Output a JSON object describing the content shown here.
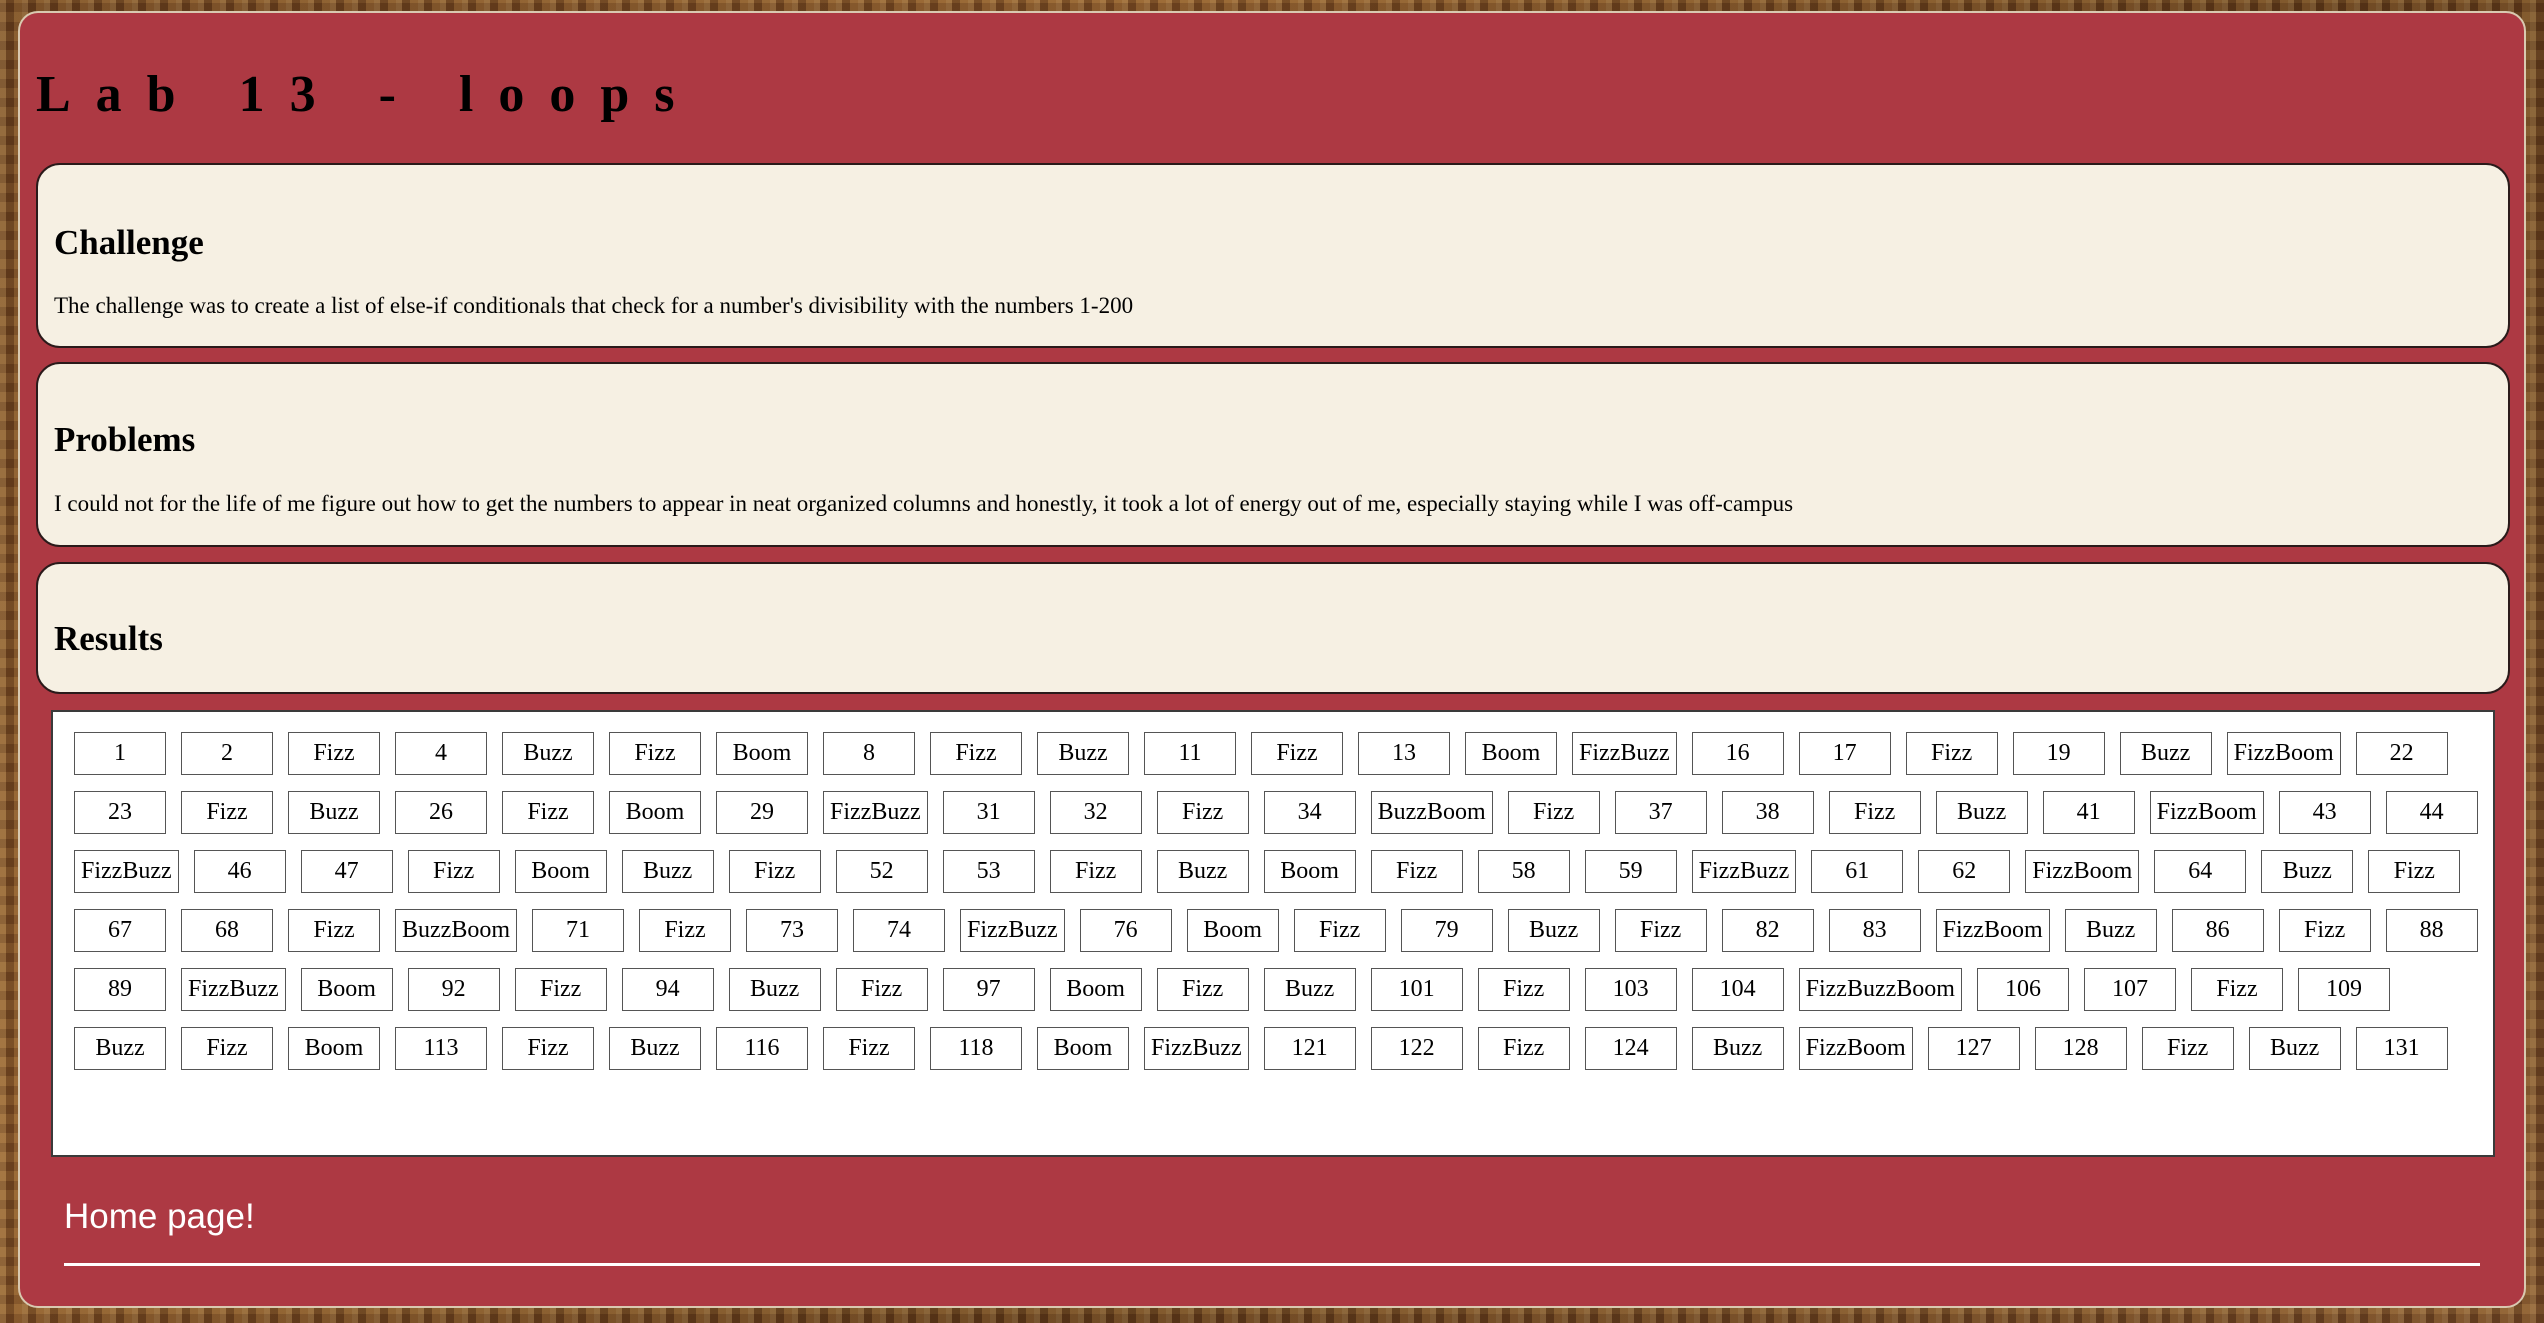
{
  "page_title": "Lab 13 - loops",
  "challenge": {
    "heading": "Challenge",
    "text": "The challenge was to create a list of else-if conditionals that check for a number's divisibility with the numbers 1-200"
  },
  "problems": {
    "heading": "Problems",
    "text": "I could not for the life of me figure out how to get the numbers to appear in neat organized columns and honestly, it took a lot of energy out of me, especially staying while I was off-campus"
  },
  "results": {
    "heading": "Results",
    "items": [
      "1",
      "2",
      "Fizz",
      "4",
      "Buzz",
      "Fizz",
      "Boom",
      "8",
      "Fizz",
      "Buzz",
      "11",
      "Fizz",
      "13",
      "Boom",
      "FizzBuzz",
      "16",
      "17",
      "Fizz",
      "19",
      "Buzz",
      "FizzBoom",
      "22",
      "23",
      "Fizz",
      "Buzz",
      "26",
      "Fizz",
      "Boom",
      "29",
      "FizzBuzz",
      "31",
      "32",
      "Fizz",
      "34",
      "BuzzBoom",
      "Fizz",
      "37",
      "38",
      "Fizz",
      "Buzz",
      "41",
      "FizzBoom",
      "43",
      "44",
      "FizzBuzz",
      "46",
      "47",
      "Fizz",
      "Boom",
      "Buzz",
      "Fizz",
      "52",
      "53",
      "Fizz",
      "Buzz",
      "Boom",
      "Fizz",
      "58",
      "59",
      "FizzBuzz",
      "61",
      "62",
      "FizzBoom",
      "64",
      "Buzz",
      "Fizz",
      "67",
      "68",
      "Fizz",
      "BuzzBoom",
      "71",
      "Fizz",
      "73",
      "74",
      "FizzBuzz",
      "76",
      "Boom",
      "Fizz",
      "79",
      "Buzz",
      "Fizz",
      "82",
      "83",
      "FizzBoom",
      "Buzz",
      "86",
      "Fizz",
      "88",
      "89",
      "FizzBuzz",
      "Boom",
      "92",
      "Fizz",
      "94",
      "Buzz",
      "Fizz",
      "97",
      "Boom",
      "Fizz",
      "Buzz",
      "101",
      "Fizz",
      "103",
      "104",
      "FizzBuzzBoom",
      "106",
      "107",
      "Fizz",
      "109",
      "Buzz",
      "Fizz",
      "Boom",
      "113",
      "Fizz",
      "Buzz",
      "116",
      "Fizz",
      "118",
      "Boom",
      "FizzBuzz",
      "121",
      "122",
      "Fizz",
      "124",
      "Buzz",
      "FizzBoom",
      "127",
      "128",
      "Fizz",
      "Buzz",
      "131"
    ]
  },
  "footer": {
    "home_link": "Home page!"
  },
  "colors": {
    "page_background": "#ad3943",
    "card_background": "#f6f0e3"
  }
}
